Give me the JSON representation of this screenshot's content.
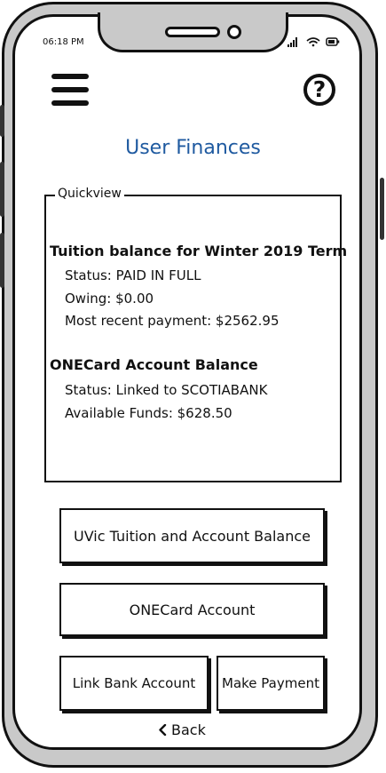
{
  "status_bar": {
    "time": "06:18 PM"
  },
  "header": {
    "menu_icon": "hamburger-menu-icon",
    "help_icon": "help-icon",
    "help_glyph": "?"
  },
  "page": {
    "title": "User Finances"
  },
  "quickview": {
    "legend": "Quickview",
    "tuition": {
      "heading": "Tuition balance for Winter 2019 Term",
      "status": "Status: PAID IN FULL",
      "owing": "Owing: $0.00",
      "recent_payment": "Most recent payment: $2562.95"
    },
    "onecard": {
      "heading": "ONECard Account Balance",
      "status": "Status: Linked to SCOTIABANK",
      "funds": "Available Funds: $628.50"
    }
  },
  "buttons": {
    "tuition_balance": "UVic Tuition and Account Balance",
    "onecard_account": "ONECard Account",
    "link_bank": "Link Bank Account",
    "make_payment": "Make Payment"
  },
  "navigation": {
    "back": "Back",
    "back_icon": "chevron-left-icon"
  }
}
